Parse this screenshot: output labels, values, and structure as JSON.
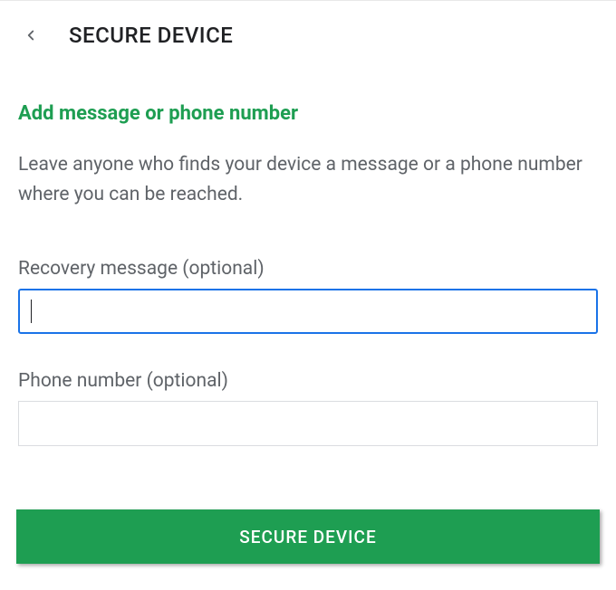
{
  "header": {
    "title": "SECURE DEVICE"
  },
  "subheading": "Add message or phone number",
  "description": "Leave anyone who finds your device a message or a phone number where you can be reached.",
  "fields": {
    "message": {
      "label": "Recovery message (optional)",
      "value": ""
    },
    "phone": {
      "label": "Phone number (optional)",
      "value": ""
    }
  },
  "button": {
    "label": "SECURE DEVICE"
  },
  "colors": {
    "accent_green": "#1e9e52",
    "focus_blue": "#1a73e8",
    "text_secondary": "#5f6368"
  }
}
